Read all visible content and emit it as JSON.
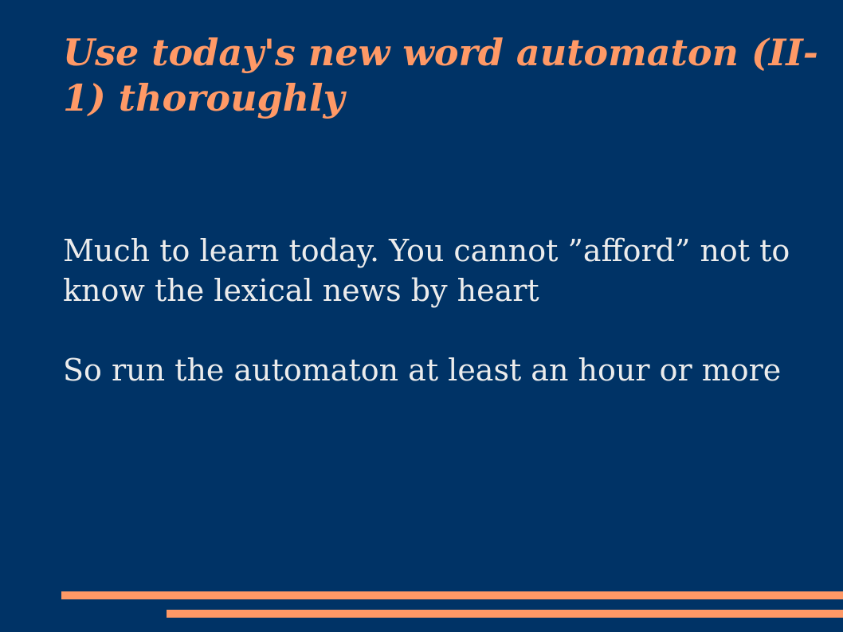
{
  "slide": {
    "title": "Use today's new word automaton (II-1) thoroughly",
    "paragraphs": [
      "Much to learn today. You cannot ”afford” not to know the lexical news by heart",
      "So run the automaton at least an hour or more"
    ]
  },
  "colors": {
    "background": "#003366",
    "accent": "#ff9966",
    "text": "#ececec"
  }
}
